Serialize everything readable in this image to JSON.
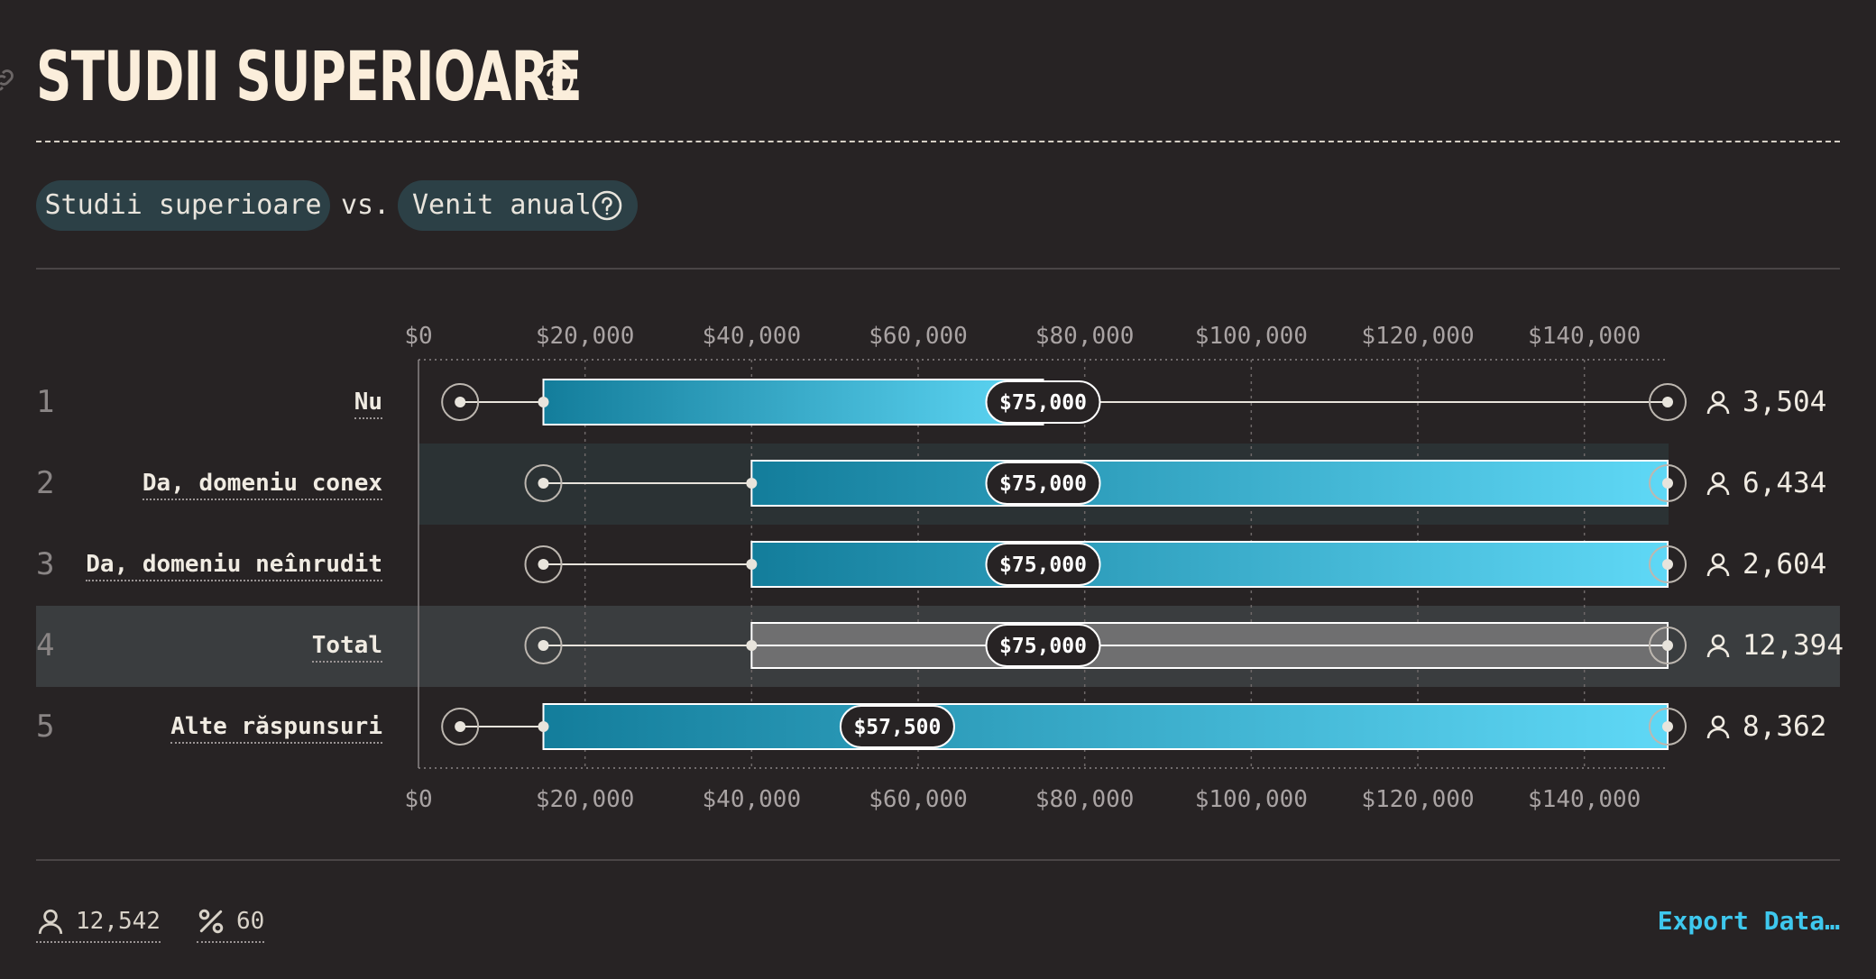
{
  "title": "STUDII SUPERIOARE",
  "compare": {
    "variable": "Studii superioare",
    "vs": "vs.",
    "metric": "Venit anual"
  },
  "chart_data": {
    "type": "box-range",
    "xlim": [
      0,
      150000
    ],
    "ticks": [
      0,
      20000,
      40000,
      60000,
      80000,
      100000,
      120000,
      140000
    ],
    "tick_labels": [
      "$0",
      "$20,000",
      "$40,000",
      "$60,000",
      "$80,000",
      "$100,000",
      "$120,000",
      "$140,000"
    ],
    "rows": [
      {
        "index": "1",
        "label": "Nu",
        "min": 5000,
        "q1": 15000,
        "median": 75000,
        "median_label": "$75,000",
        "q3": 75000,
        "max": 150000,
        "count": "3,504",
        "style": "blue"
      },
      {
        "index": "2",
        "label": "Da, domeniu conex",
        "min": 15000,
        "q1": 40000,
        "median": 75000,
        "median_label": "$75,000",
        "q3": 150000,
        "max": 150000,
        "count": "6,434",
        "style": "blue"
      },
      {
        "index": "3",
        "label": "Da, domeniu neînrudit",
        "min": 15000,
        "q1": 40000,
        "median": 75000,
        "median_label": "$75,000",
        "q3": 150000,
        "max": 150000,
        "count": "2,604",
        "style": "blue"
      },
      {
        "index": "4",
        "label": "Total",
        "min": 15000,
        "q1": 40000,
        "median": 75000,
        "median_label": "$75,000",
        "q3": 150000,
        "max": 150000,
        "count": "12,394",
        "style": "gray"
      },
      {
        "index": "5",
        "label": "Alte răspunsuri",
        "min": 5000,
        "q1": 15000,
        "median": 57500,
        "median_label": "$57,500",
        "q3": 150000,
        "max": 150000,
        "count": "8,362",
        "style": "blue"
      }
    ]
  },
  "footer": {
    "respondents": "12,542",
    "percent": "60",
    "export_label": "Export Data…"
  },
  "colors": {
    "accent": "#3ec8ee",
    "bar_dark": "#137d9b",
    "bar_light": "#5fd8f6",
    "pill": "#2c4046"
  },
  "icons": {
    "person": "person-icon",
    "percent": "percent-icon",
    "help": "help-circle-icon",
    "link": "link-icon"
  }
}
